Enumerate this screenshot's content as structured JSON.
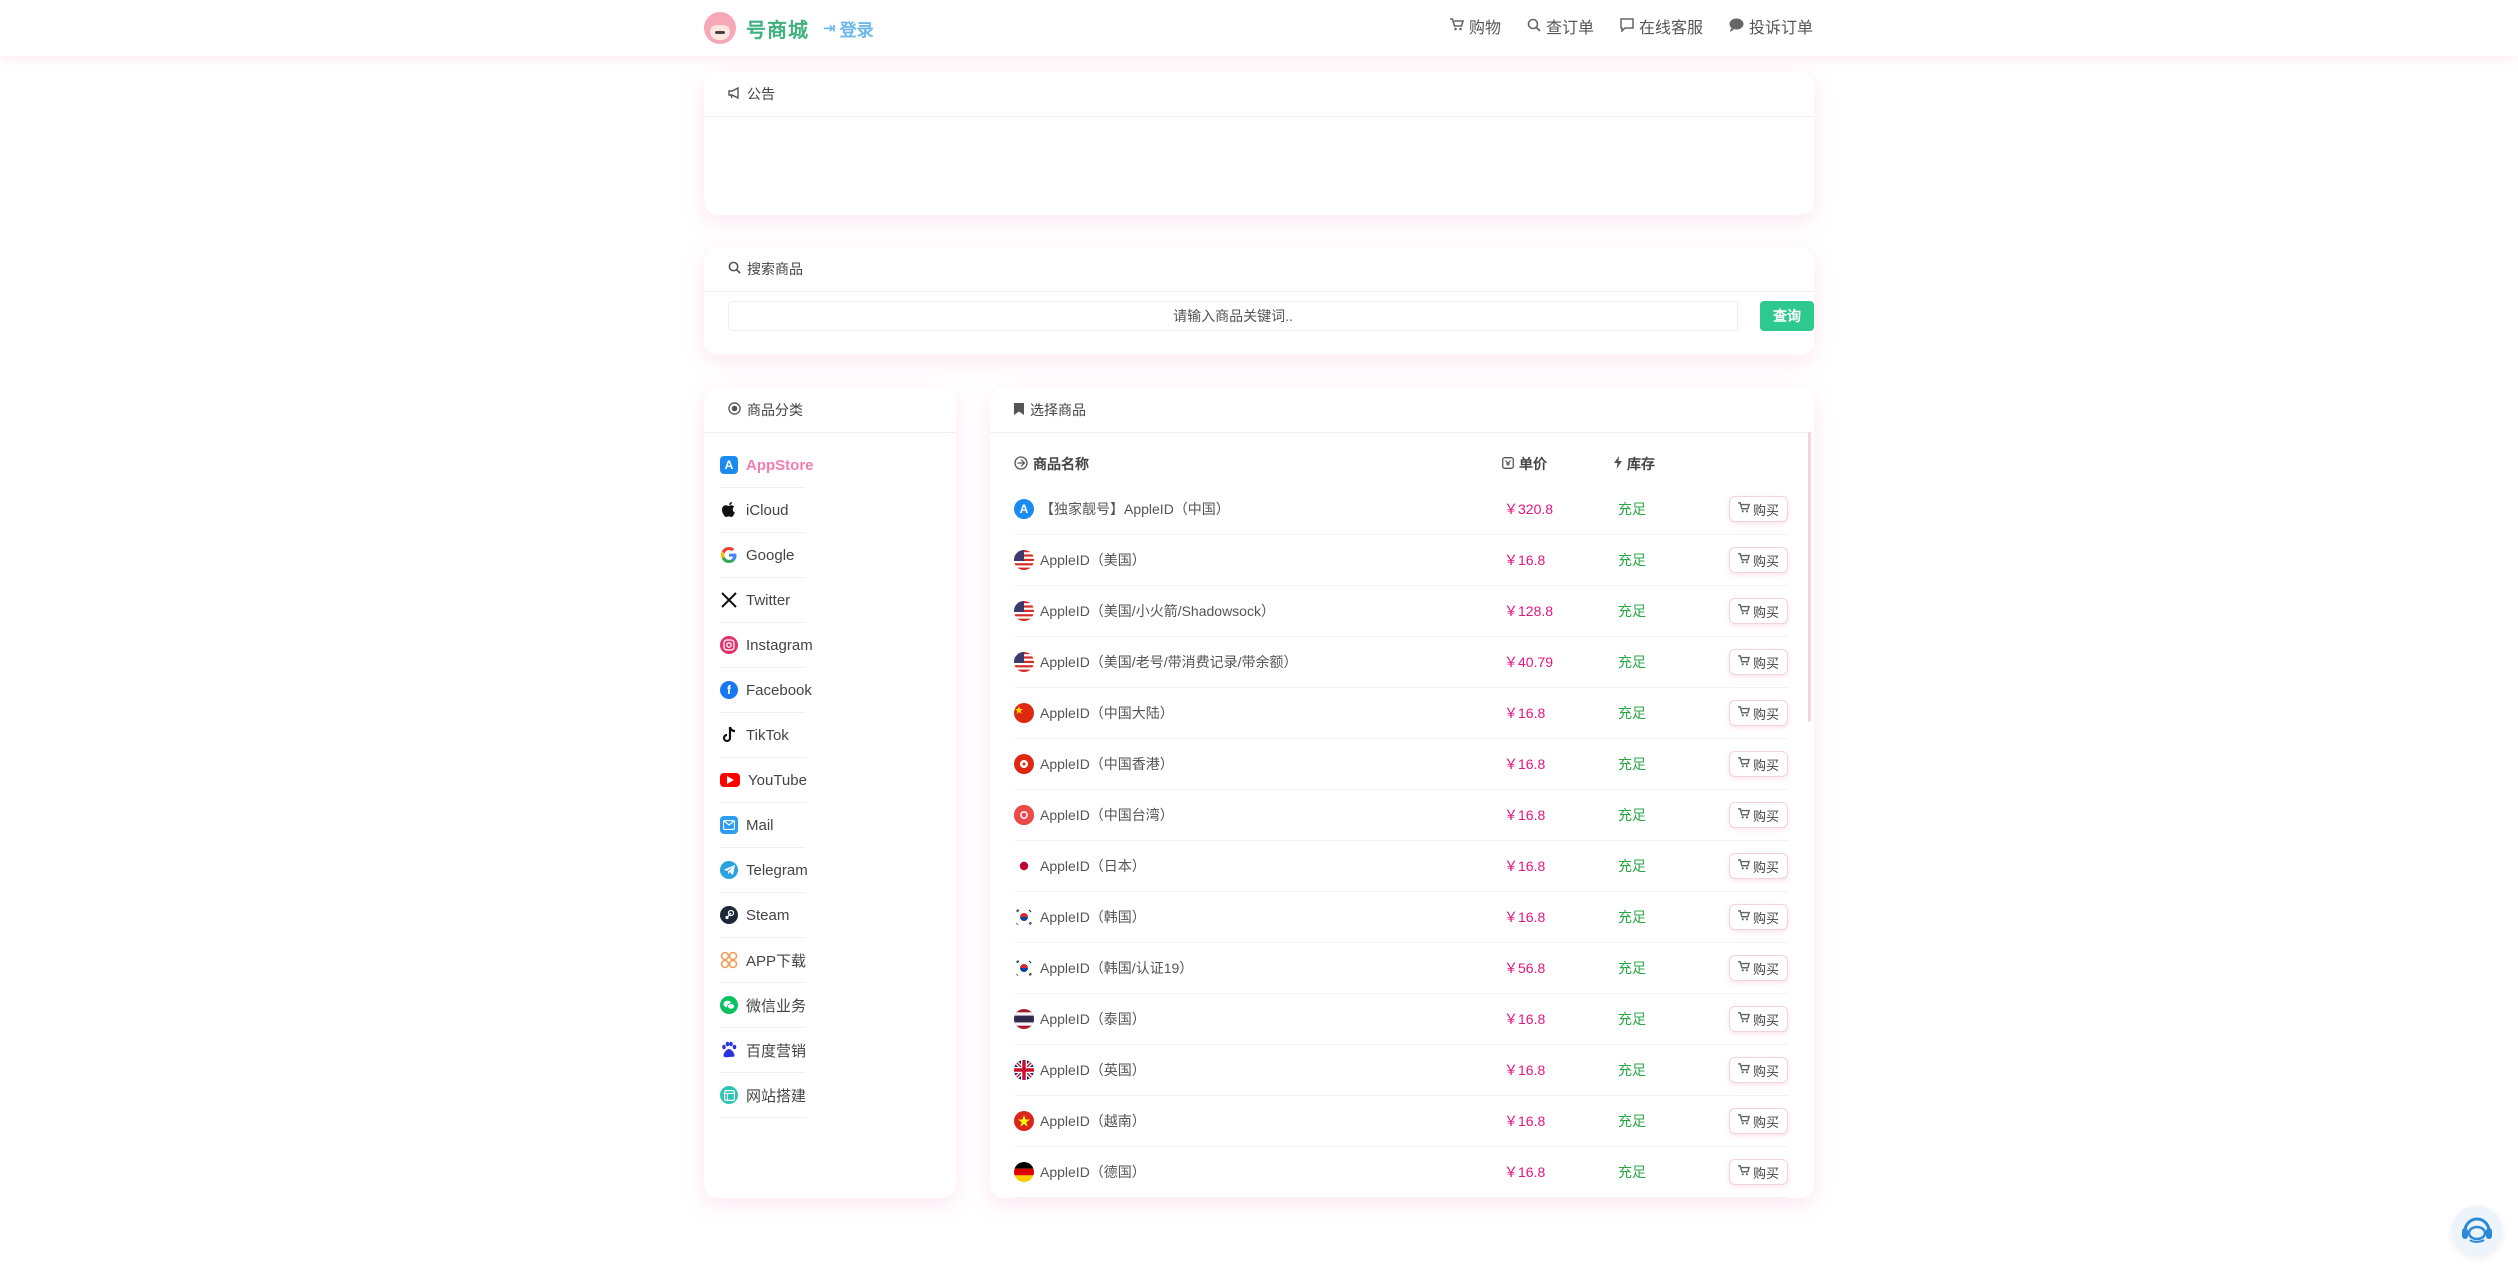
{
  "header": {
    "brand": "号商城",
    "login": "登录",
    "nav": [
      {
        "label": "购物",
        "icon": "cart-icon"
      },
      {
        "label": "查订单",
        "icon": "search-icon"
      },
      {
        "label": "在线客服",
        "icon": "message-icon"
      },
      {
        "label": "投诉订单",
        "icon": "chat-bubble-icon"
      }
    ]
  },
  "notice": {
    "title": "公告"
  },
  "search": {
    "title": "搜索商品",
    "placeholder": "请输入商品关键词..",
    "button": "查询"
  },
  "categories": {
    "title": "商品分类",
    "items": [
      {
        "label": "AppStore",
        "icon": "appstore-icon",
        "active": true
      },
      {
        "label": "iCloud",
        "icon": "apple-icon"
      },
      {
        "label": "Google",
        "icon": "google-icon"
      },
      {
        "label": "Twitter",
        "icon": "x-twitter-icon"
      },
      {
        "label": "Instagram",
        "icon": "instagram-icon"
      },
      {
        "label": "Facebook",
        "icon": "facebook-icon"
      },
      {
        "label": "TikTok",
        "icon": "tiktok-icon"
      },
      {
        "label": "YouTube",
        "icon": "youtube-icon"
      },
      {
        "label": "Mail",
        "icon": "mail-icon"
      },
      {
        "label": "Telegram",
        "icon": "telegram-icon"
      },
      {
        "label": "Steam",
        "icon": "steam-icon"
      },
      {
        "label": "APP下载",
        "icon": "app-download-icon"
      },
      {
        "label": "微信业务",
        "icon": "wechat-icon"
      },
      {
        "label": "百度营销",
        "icon": "baidu-icon"
      },
      {
        "label": "网站搭建",
        "icon": "website-icon"
      }
    ]
  },
  "products": {
    "title": "选择商品",
    "columns": {
      "name": "商品名称",
      "price": "单价",
      "stock": "库存"
    },
    "buy_label": "购买",
    "rows": [
      {
        "name": "【独家靓号】AppleID（中国）",
        "price": "￥320.8",
        "stock": "充足",
        "flag": "appstore"
      },
      {
        "name": "AppleID（美国）",
        "price": "￥16.8",
        "stock": "充足",
        "flag": "us"
      },
      {
        "name": "AppleID（美国/小火箭/Shadowsock）",
        "price": "￥128.8",
        "stock": "充足",
        "flag": "us"
      },
      {
        "name": "AppleID（美国/老号/带消费记录/带余额）",
        "price": "￥40.79",
        "stock": "充足",
        "flag": "us"
      },
      {
        "name": "AppleID（中国大陆）",
        "price": "￥16.8",
        "stock": "充足",
        "flag": "cn"
      },
      {
        "name": "AppleID（中国香港）",
        "price": "￥16.8",
        "stock": "充足",
        "flag": "hk"
      },
      {
        "name": "AppleID（中国台湾）",
        "price": "￥16.8",
        "stock": "充足",
        "flag": "tw"
      },
      {
        "name": "AppleID（日本）",
        "price": "￥16.8",
        "stock": "充足",
        "flag": "jp"
      },
      {
        "name": "AppleID（韩国）",
        "price": "￥16.8",
        "stock": "充足",
        "flag": "kr"
      },
      {
        "name": "AppleID（韩国/认证19）",
        "price": "￥56.8",
        "stock": "充足",
        "flag": "kr"
      },
      {
        "name": "AppleID（泰国）",
        "price": "￥16.8",
        "stock": "充足",
        "flag": "th"
      },
      {
        "name": "AppleID（英国）",
        "price": "￥16.8",
        "stock": "充足",
        "flag": "gb"
      },
      {
        "name": "AppleID（越南）",
        "price": "￥16.8",
        "stock": "充足",
        "flag": "vn"
      },
      {
        "name": "AppleID（德国）",
        "price": "￥16.8",
        "stock": "充足",
        "flag": "de"
      }
    ]
  },
  "colors": {
    "brand": "#3fb27f",
    "accent_pink": "#f57cb0",
    "price": "#e4157f",
    "stock": "#28a745",
    "search_button": "#2dc98f"
  }
}
